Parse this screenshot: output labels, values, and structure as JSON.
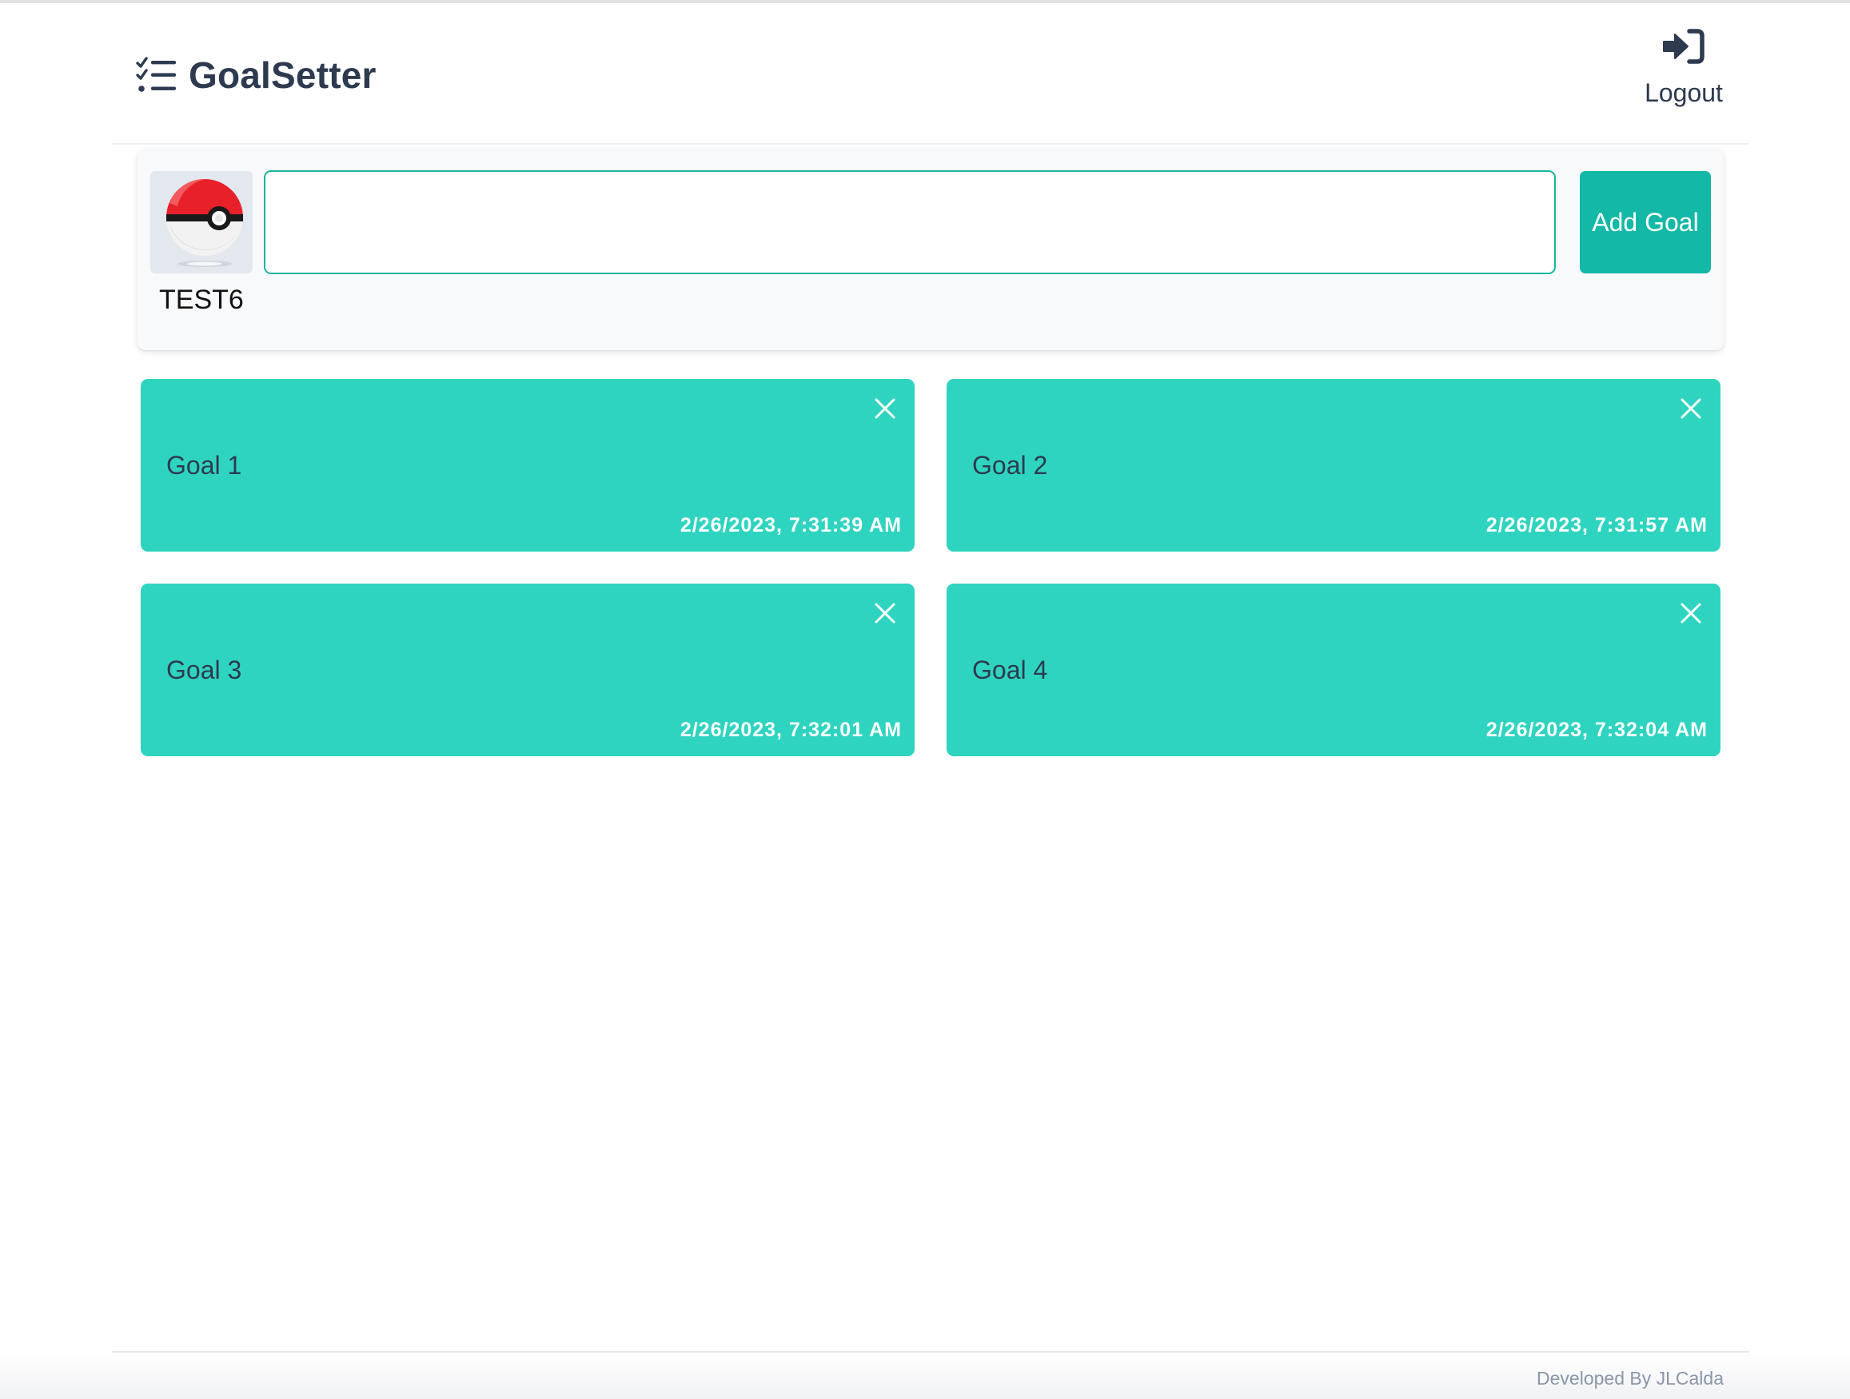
{
  "header": {
    "brand_title": "GoalSetter",
    "brand_icon": "checklist-icon",
    "logout_label": "Logout",
    "logout_icon": "sign-in-icon"
  },
  "composer": {
    "avatar_icon": "pokeball-icon",
    "username": "TEST6",
    "input_value": "",
    "input_placeholder": "",
    "add_button_label": "Add Goal"
  },
  "goals": [
    {
      "title": "Goal 1",
      "date": "2/26/2023, 7:31:39 AM"
    },
    {
      "title": "Goal 2",
      "date": "2/26/2023, 7:31:57 AM"
    },
    {
      "title": "Goal 3",
      "date": "2/26/2023, 7:32:01 AM"
    },
    {
      "title": "Goal 4",
      "date": "2/26/2023, 7:32:04 AM"
    }
  ],
  "footer": {
    "credit": "Developed By JLCalda"
  },
  "colors": {
    "accent": "#14b8a6",
    "card": "#2fd4c0",
    "text_dark": "#2d3a4f",
    "footer_text": "#8a96a8"
  }
}
